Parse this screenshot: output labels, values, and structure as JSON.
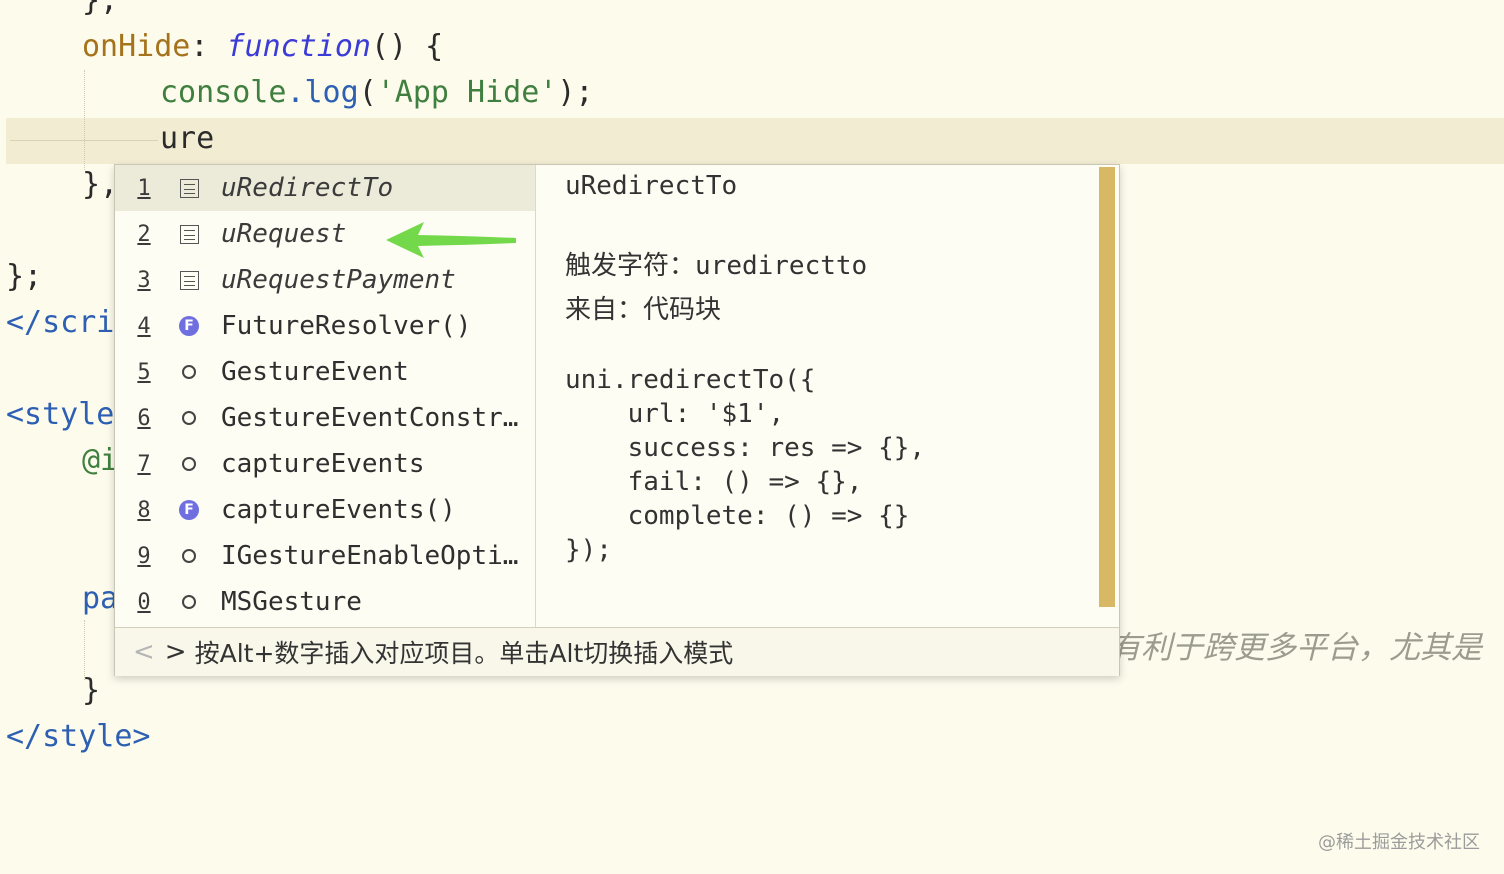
{
  "editor": {
    "lines": {
      "l0": "},",
      "l1_prop": "onHide",
      "l1_colon": ": ",
      "l1_fn": "function",
      "l1_rest": "() {",
      "l2_obj": "console",
      "l2_dot": ".",
      "l2_method": "log",
      "l2_open": "(",
      "l2_str": "'App Hide'",
      "l2_close": ");",
      "l3_typed": "ure",
      "l4": "},",
      "l5": "};",
      "l6": "</scri",
      "l7": "<style",
      "l8": "@i",
      "l9": "pa",
      "l10": "}",
      "l11": "</style>"
    },
    "hidden_comment": "有利于跨更多平台，尤其是"
  },
  "autocomplete": {
    "items": [
      {
        "num": "1",
        "icon": "snippet-icon",
        "label": "uRedirectTo"
      },
      {
        "num": "2",
        "icon": "snippet-icon",
        "label": "uRequest"
      },
      {
        "num": "3",
        "icon": "snippet-icon",
        "label": "uRequestPayment"
      },
      {
        "num": "4",
        "icon": "function-icon",
        "icon_text": "F",
        "label": "FutureResolver()"
      },
      {
        "num": "5",
        "icon": "property-icon",
        "label": "GestureEvent"
      },
      {
        "num": "6",
        "icon": "property-icon",
        "label": "GestureEventConstr…"
      },
      {
        "num": "7",
        "icon": "property-icon",
        "label": "captureEvents"
      },
      {
        "num": "8",
        "icon": "function-icon",
        "icon_text": "F",
        "label": "captureEvents()"
      },
      {
        "num": "9",
        "icon": "property-icon",
        "label": "IGestureEnableOpti…"
      },
      {
        "num": "0",
        "icon": "property-icon",
        "label": "MSGesture"
      }
    ],
    "detail": {
      "title": "uRedirectTo",
      "trigger_label": "触发字符：",
      "trigger_value": "uredirectto",
      "source_label": "来自：",
      "source_value": "代码块",
      "code": [
        "uni.redirectTo({",
        "    url: '$1',",
        "    success: res => {},",
        "    fail: () => {},",
        "    complete: () => {}",
        "});"
      ]
    },
    "footer": {
      "prev": "<",
      "next": ">",
      "hint": "按Alt+数字插入对应项目。单击Alt切换插入模式"
    }
  },
  "watermark": "@稀土掘金技术社区",
  "colors": {
    "background": "#fdfbec",
    "current_line": "#f2ecd2",
    "scrollbar": "#d8b865",
    "arrow": "#74d94a"
  }
}
